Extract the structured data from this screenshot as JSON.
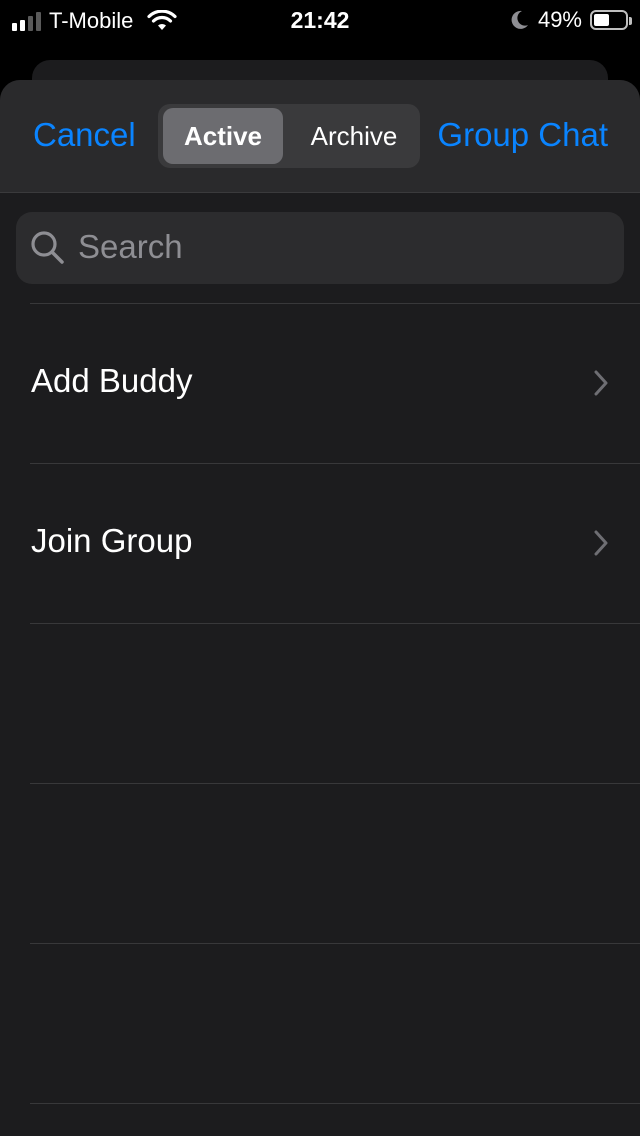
{
  "status_bar": {
    "carrier": "T-Mobile",
    "time": "21:42",
    "battery_percent": "49%",
    "battery_level": 0.49,
    "icons": [
      "signal-icon",
      "wifi-icon",
      "moon-icon",
      "battery-icon"
    ]
  },
  "nav": {
    "cancel_label": "Cancel",
    "segments": [
      "Active",
      "Archive"
    ],
    "selected_segment": "Active",
    "group_chat_label": "Group Chat"
  },
  "search": {
    "placeholder": "Search"
  },
  "rows": [
    {
      "label": "Add Buddy"
    },
    {
      "label": "Join Group"
    }
  ],
  "colors": {
    "accent": "#0a84ff",
    "background": "#1c1c1e",
    "nav_background": "#2a2a2c",
    "search_background": "#2c2c2e",
    "separator": "#38383a"
  }
}
